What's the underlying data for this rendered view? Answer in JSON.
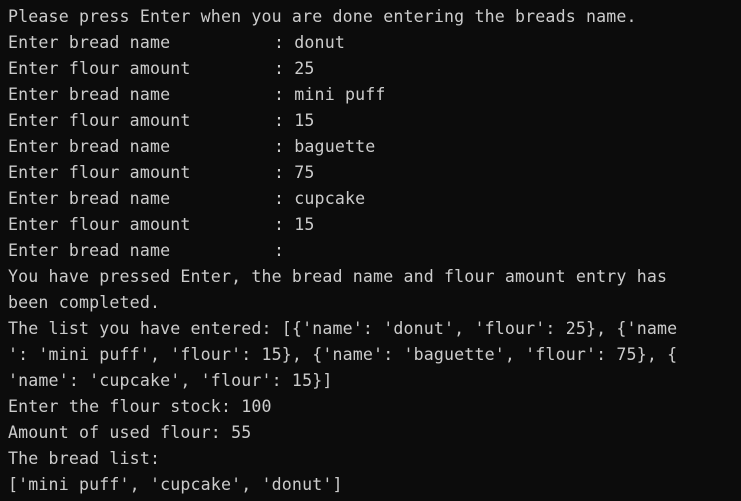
{
  "terminal": {
    "cutoff_fragment": "...",
    "prompt_intro": "Please press Enter when you are done entering the breads name.",
    "entries": [
      {
        "label": "Enter bread name",
        "value": ": donut"
      },
      {
        "label": "Enter flour amount",
        "value": ": 25"
      },
      {
        "label": "Enter bread name",
        "value": ": mini puff"
      },
      {
        "label": "Enter flour amount",
        "value": ": 15"
      },
      {
        "label": "Enter bread name",
        "value": ": baguette"
      },
      {
        "label": "Enter flour amount",
        "value": ": 75"
      },
      {
        "label": "Enter bread name",
        "value": ": cupcake"
      },
      {
        "label": "Enter flour amount",
        "value": ": 15"
      },
      {
        "label": "Enter bread name",
        "value": ":"
      }
    ],
    "completion_line_1": "You have pressed Enter, the bread name and flour amount entry has",
    "completion_line_2": "been completed.",
    "list_line_1": "The list you have entered: [{'name': 'donut', 'flour': 25}, {'name",
    "list_line_2": "': 'mini puff', 'flour': 15}, {'name': 'baguette', 'flour': 75}, {",
    "list_line_3": "'name': 'cupcake', 'flour': 15}]",
    "stock_line": "Enter the flour stock: 100",
    "used_line": "Amount of used flour: 55",
    "bread_list_heading": "The bread list:",
    "bread_list_value": "['mini puff', 'cupcake', 'donut']"
  }
}
